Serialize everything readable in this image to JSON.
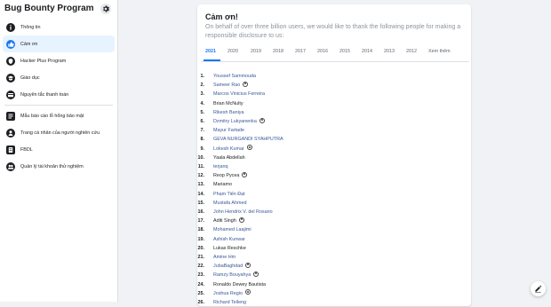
{
  "sidebar": {
    "title": "Bug Bounty Program",
    "items": [
      {
        "label": "Thông tin",
        "icon": "info-icon",
        "active": false
      },
      {
        "label": "Cảm ơn",
        "icon": "thumbs-up-icon",
        "active": true
      },
      {
        "label": "Hacker Plus Program",
        "icon": "hacker-plus-icon",
        "active": false
      },
      {
        "label": "Giáo dục",
        "icon": "education-icon",
        "active": false
      },
      {
        "label": "Nguyên tắc thanh toán",
        "icon": "payment-icon",
        "active": false
      },
      {
        "label": "Mẫu báo cáo lỗ hổng bảo mật",
        "icon": "report-icon",
        "active": false
      },
      {
        "label": "Trang cá nhân của người nghiên cứu",
        "icon": "researcher-profile-icon",
        "active": false
      },
      {
        "label": "FBDL",
        "icon": "document-icon",
        "active": false
      },
      {
        "label": "Quản lý tài khoản thử nghiệm",
        "icon": "test-accounts-icon",
        "active": false
      }
    ]
  },
  "main": {
    "title": "Cảm ơn!",
    "subtitle": "On behalf of over three billion users, we would like to thank the following people for making a responsible disclosure to us:",
    "years": [
      "2021",
      "2020",
      "2019",
      "2018",
      "2017",
      "2016",
      "2015",
      "2014",
      "2013",
      "2012",
      "Xem thêm"
    ],
    "active_year": "2021",
    "thanks": [
      {
        "num": "1.",
        "name": "Youssef Sammouda",
        "link": true,
        "badge": false
      },
      {
        "num": "2.",
        "name": "Sameer Rao",
        "link": true,
        "badge": true
      },
      {
        "num": "3.",
        "name": "Marcos Vinicius Ferreira",
        "link": true,
        "badge": false
      },
      {
        "num": "4.",
        "name": "Brian McNulty",
        "link": false,
        "badge": false
      },
      {
        "num": "5.",
        "name": "Rikesh Baniya",
        "link": true,
        "badge": false
      },
      {
        "num": "6.",
        "name": "Dzmitry Lukyanenka",
        "link": true,
        "badge": true
      },
      {
        "num": "7.",
        "name": "Mayur Fartade",
        "link": true,
        "badge": false
      },
      {
        "num": "8.",
        "name": "GEVA NURGANDI SYAHPUTRA",
        "link": true,
        "badge": false
      },
      {
        "num": "9.",
        "name": "Lokesh Kumar",
        "link": true,
        "badge": true
      },
      {
        "num": "10.",
        "name": "Yaala Abdellah",
        "link": false,
        "badge": false
      },
      {
        "num": "11.",
        "name": "terjanq",
        "link": true,
        "badge": false
      },
      {
        "num": "12.",
        "name": "Reop Pycea",
        "link": false,
        "badge": true
      },
      {
        "num": "13.",
        "name": "Mariamo",
        "link": false,
        "badge": false
      },
      {
        "num": "14.",
        "name": "Phạm Tiến Đạt",
        "link": true,
        "badge": false
      },
      {
        "num": "15.",
        "name": "Mustafa Ahmed",
        "link": true,
        "badge": false
      },
      {
        "num": "16.",
        "name": "John Hendrix V. del Rosario",
        "link": true,
        "badge": false
      },
      {
        "num": "17.",
        "name": "Aditi Singh",
        "link": false,
        "badge": true
      },
      {
        "num": "18.",
        "name": "Mohamed Laajimi",
        "link": true,
        "badge": false
      },
      {
        "num": "19.",
        "name": "Ashish Kunwar",
        "link": true,
        "badge": false
      },
      {
        "num": "20.",
        "name": "Lukas Reschke",
        "link": false,
        "badge": false
      },
      {
        "num": "21.",
        "name": "Amine Hm",
        "link": true,
        "badge": false
      },
      {
        "num": "22.",
        "name": "JubaBaghdad",
        "link": true,
        "badge": true
      },
      {
        "num": "23.",
        "name": "Ramzy Bouyahya",
        "link": true,
        "badge": true
      },
      {
        "num": "24.",
        "name": "Ronaldo Dewey Bautista",
        "link": false,
        "badge": false
      },
      {
        "num": "25.",
        "name": "Joshua Regio",
        "link": true,
        "badge": true
      },
      {
        "num": "26.",
        "name": "Richard Telleng",
        "link": true,
        "badge": false
      }
    ]
  },
  "colors": {
    "accent": "#1877f2",
    "link": "#385898",
    "active_bg": "#e7f3ff"
  }
}
